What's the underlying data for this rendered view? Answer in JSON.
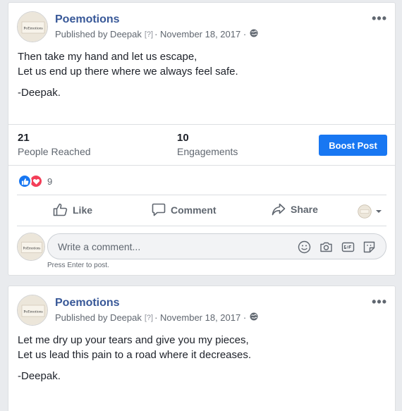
{
  "posts": [
    {
      "page_name": "Poemotions",
      "published_by": "Published by Deepak",
      "help_marker": "[?]",
      "date": "· November 18, 2017 ·",
      "avatar_text": "PoEmotions",
      "more_icon": "ellipsis-icon",
      "lines": [
        "Then take my hand and let us escape,",
        "Let us end up there where we always feel safe."
      ],
      "signature": "-Deepak.",
      "stats": {
        "reached_value": "21",
        "reached_label": "People Reached",
        "engagements_value": "10",
        "engagements_label": "Engagements",
        "boost_label": "Boost Post"
      },
      "reaction_count": "9",
      "actions": {
        "like": "Like",
        "comment": "Comment",
        "share": "Share"
      },
      "comment_placeholder": "Write a comment...",
      "comment_hint": "Press Enter to post."
    },
    {
      "page_name": "Poemotions",
      "published_by": "Published by Deepak",
      "help_marker": "[?]",
      "date": "· November 18, 2017 ·",
      "avatar_text": "PoEmotions",
      "more_icon": "ellipsis-icon",
      "lines": [
        "Let me dry up your tears and give you my pieces,",
        "Let us lead this pain to a road where it decreases."
      ],
      "signature": "-Deepak."
    }
  ],
  "colors": {
    "page_background": "#e9ebee",
    "link_blue": "#385898",
    "boost_blue": "#1877f2",
    "love_red": "#f33e58"
  }
}
